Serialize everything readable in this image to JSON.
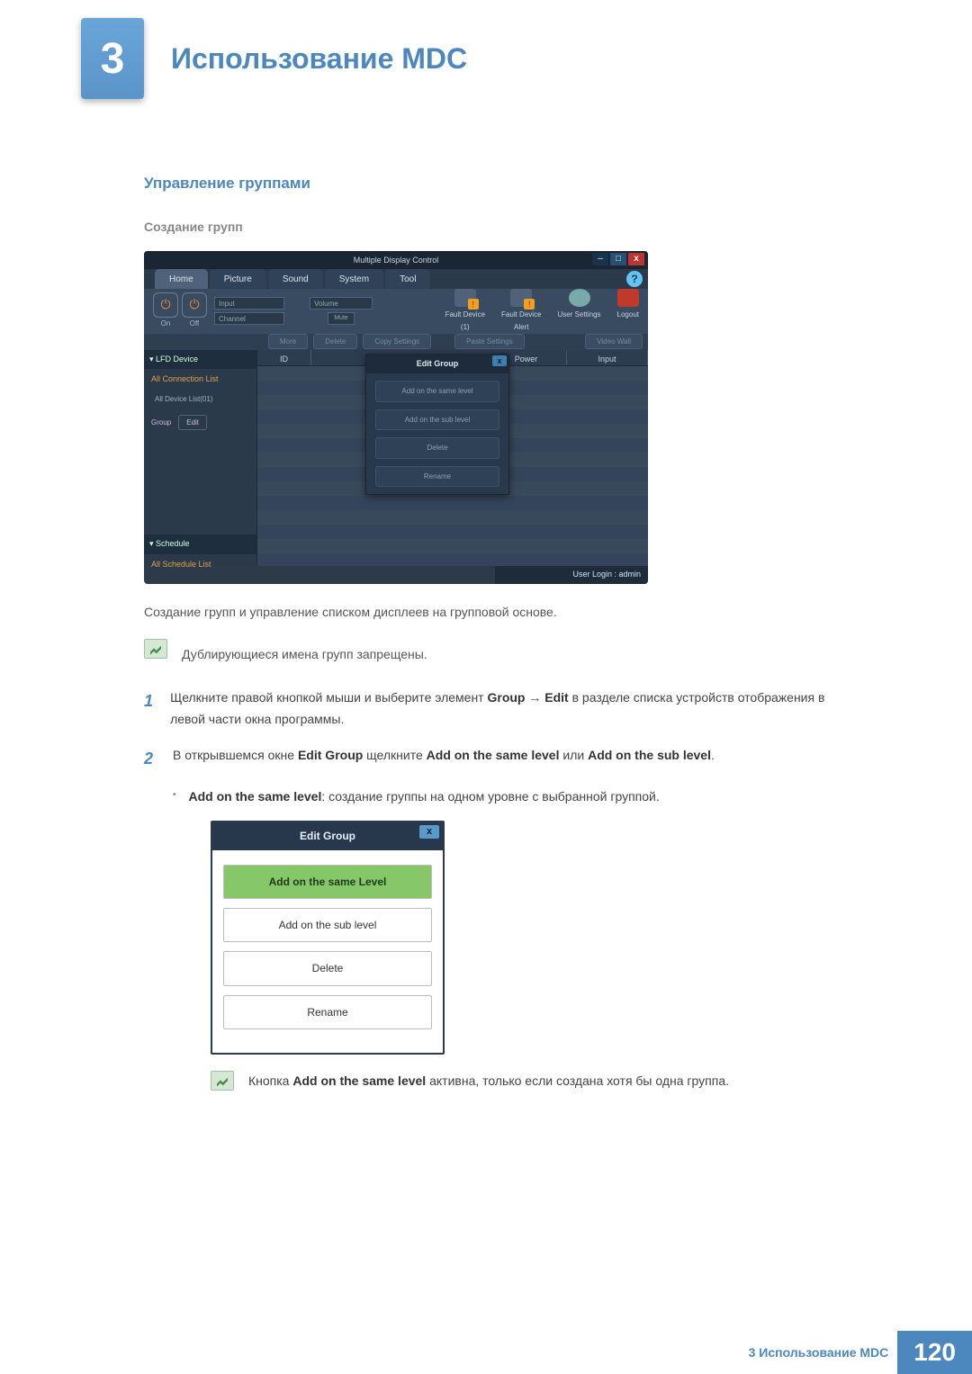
{
  "chapter": {
    "number": "3",
    "title": "Использование MDC"
  },
  "section": {
    "h1": "Управление группами",
    "h2": "Создание групп"
  },
  "screenshot": {
    "window_title": "Multiple Display Control",
    "menu": [
      "Home",
      "Picture",
      "Sound",
      "System",
      "Tool"
    ],
    "toolbar": {
      "power": {
        "on": "On",
        "off": "Off"
      },
      "input_label": "Input",
      "channel_label": "Channel",
      "volume_label": "Volume",
      "mute_label": "Mute",
      "icons": {
        "fault_device": "Fault Device\n(1)",
        "fault_alert": "Fault Device\nAlert",
        "user_settings": "User Settings",
        "logout": "Logout"
      }
    },
    "ribbon": {
      "more": "More",
      "delete": "Delete",
      "copy": "Copy Settings",
      "paste": "Paste Settings",
      "videowall": "Video Wall"
    },
    "sidebar": {
      "lfd_header": "LFD Device",
      "all_conn": "All Connection List",
      "all_dev": "All Device List(01)",
      "group_label": "Group",
      "edit_btn": "Edit",
      "schedule_header": "Schedule",
      "all_sched": "All Schedule List"
    },
    "list_header": {
      "id": "ID",
      "power": "Power",
      "input": "Input"
    },
    "edit_popup": {
      "title": "Edit Group",
      "same": "Add on the same level",
      "sub": "Add on the sub level",
      "delete": "Delete",
      "rename": "Rename"
    },
    "status": "User Login : admin"
  },
  "text": {
    "caption": "Создание групп и управление списком дисплеев на групповой основе.",
    "note1": "Дублирующиеся имена групп запрещены.",
    "step1_pre": "Щелкните правой кнопкой мыши и выберите элемент ",
    "step1_b1": "Group",
    "step1_arrow": " → ",
    "step1_b2": "Edit",
    "step1_post": " в разделе списка устройств отображения в левой части окна программы.",
    "step2_pre": "В открывшемся окне ",
    "step2_b1": "Edit Group",
    "step2_mid1": " щелкните ",
    "step2_b2": "Add on the same level",
    "step2_mid2": " или ",
    "step2_b3": "Add on the sub level",
    "step2_post": ".",
    "bullet1_b": "Add on the same level",
    "bullet1_rest": ": создание группы на одном уровне с выбранной группой.",
    "note2_pre": "Кнопка ",
    "note2_b": "Add on the same level",
    "note2_post": " активна, только если создана хотя бы одна группа."
  },
  "dialog": {
    "title": "Edit Group",
    "same": "Add on the same Level",
    "sub": "Add on the sub level",
    "delete": "Delete",
    "rename": "Rename"
  },
  "footer": {
    "label": "3 Использование MDC",
    "page": "120"
  }
}
